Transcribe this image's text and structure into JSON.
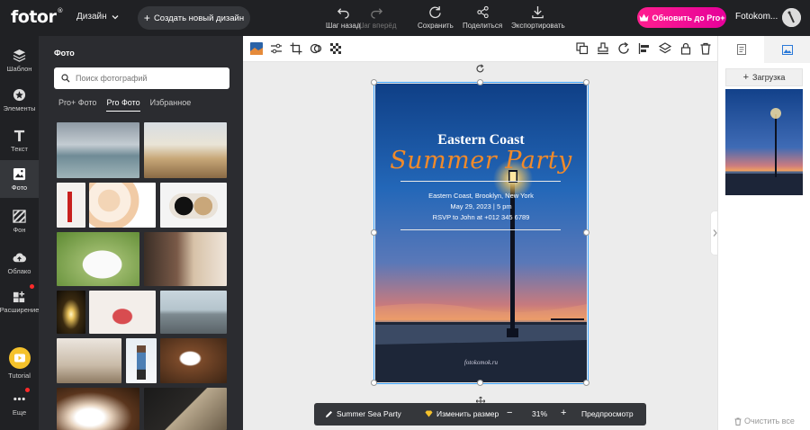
{
  "app": {
    "logo": "fotor",
    "menu_design": "Дизайн",
    "new_design": "Создать новый дизайн",
    "actions": [
      {
        "label": "Шаг назад",
        "icon": "undo-icon",
        "enabled": true
      },
      {
        "label": "Шаг вперёд",
        "icon": "redo-icon",
        "enabled": false
      },
      {
        "label": "Сохранить",
        "icon": "save-icon",
        "enabled": true
      },
      {
        "label": "Поделиться",
        "icon": "share-icon",
        "enabled": true
      },
      {
        "label": "Экспортировать",
        "icon": "export-icon",
        "enabled": true
      }
    ],
    "upgrade": "Обновить до Pro+",
    "username": "Fotokom..."
  },
  "leftnav": {
    "items": [
      {
        "label": "Шаблон",
        "icon": "template-icon"
      },
      {
        "label": "Элементы",
        "icon": "elements-icon"
      },
      {
        "label": "Текст",
        "icon": "text-icon"
      },
      {
        "label": "Фото",
        "icon": "photo-icon"
      },
      {
        "label": "Фон",
        "icon": "background-icon"
      },
      {
        "label": "Облако",
        "icon": "cloud-icon"
      },
      {
        "label": "Расширение",
        "icon": "extension-icon"
      },
      {
        "label": "Tutorial",
        "icon": "tutorial-icon"
      },
      {
        "label": "Еще",
        "icon": "more-icon"
      }
    ],
    "active": "Фото"
  },
  "photo_panel": {
    "title": "Фото",
    "search_placeholder": "Поиск фотографий",
    "tabs": [
      "Pro+ Фото",
      "Pro Фото",
      "Избранное"
    ],
    "active_tab": "Pro Фото"
  },
  "poster": {
    "title": "Eastern Coast",
    "subtitle": "Summer Party",
    "line1": "Eastern Coast, Brooklyn, New York",
    "line2": "May 29, 2023 | 5 pm",
    "line3": "RSVP to John at +012 345 6789",
    "watermark": "fotokomok.ru"
  },
  "bottombar": {
    "project_name": "Summer Sea Party",
    "resize": "Изменить размер",
    "zoom": "31%",
    "preview": "Предпросмотр",
    "zoom_out": "−",
    "zoom_in": "+"
  },
  "rightpanel": {
    "upload": "Загрузка",
    "clear_all": "Очистить все"
  },
  "colors": {
    "accent_pink": "#e5009a",
    "selection_blue": "#3ba3ff",
    "poster_orange": "#f08a2a",
    "tutorial_yellow": "#f5c22b"
  }
}
